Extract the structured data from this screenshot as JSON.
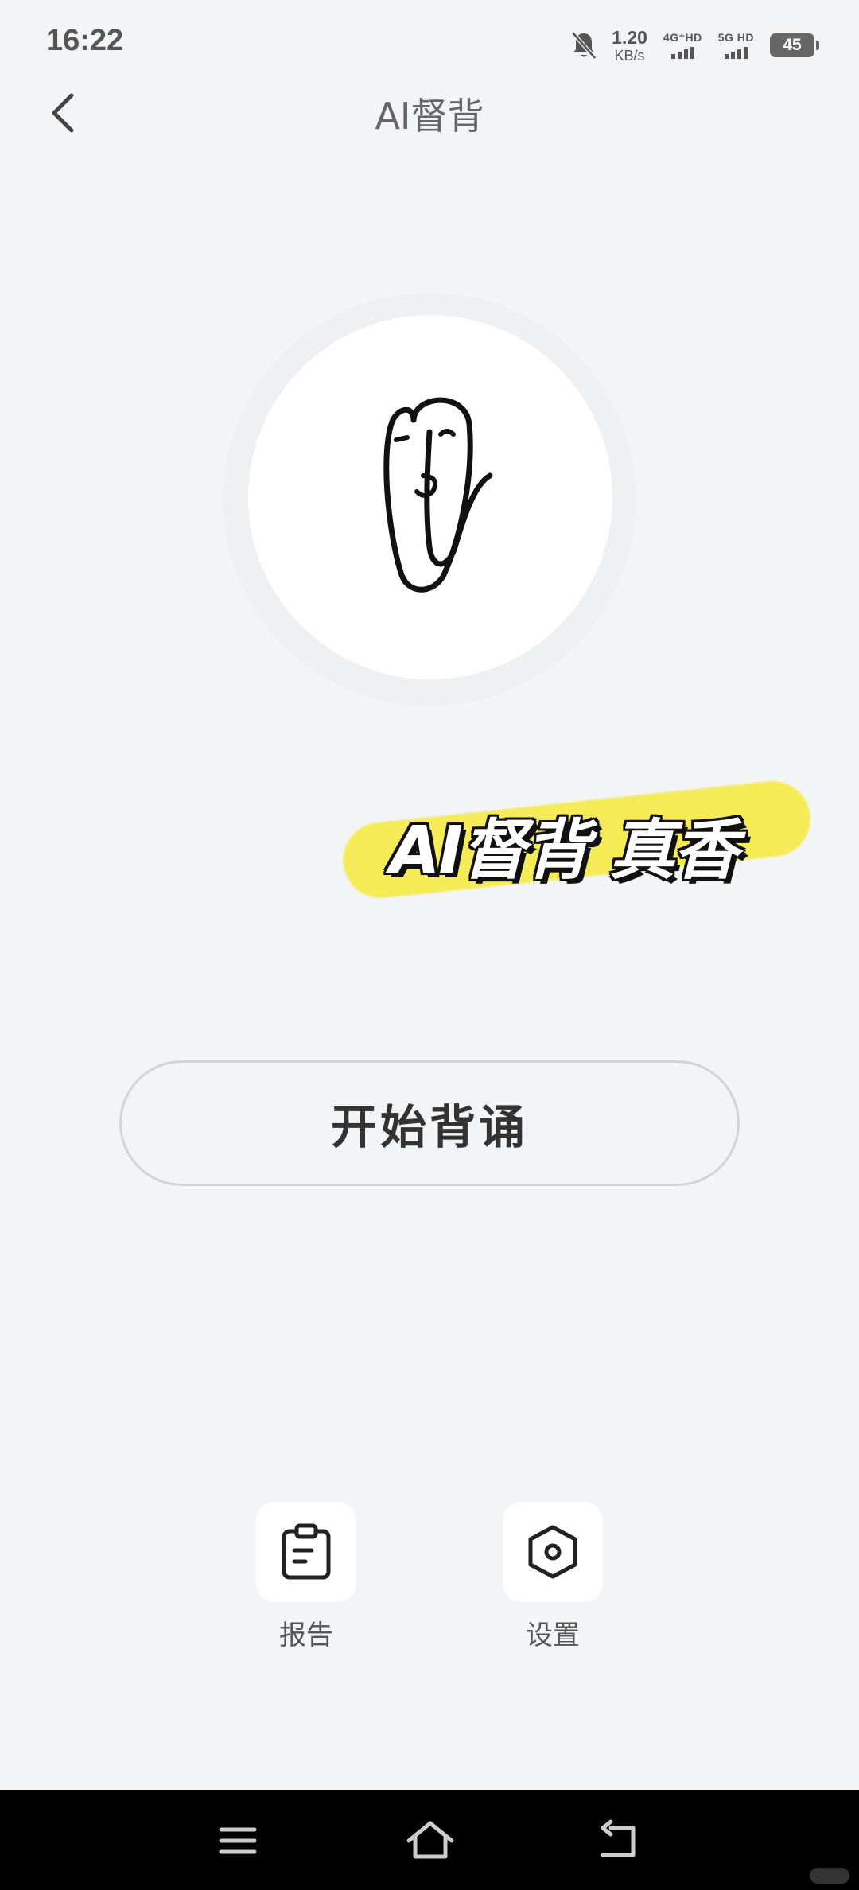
{
  "status_bar": {
    "time": "16:22",
    "speed_value": "1.20",
    "speed_unit": "KB/s",
    "sim1_label": "4G⁺HD",
    "sim2_label": "5G HD",
    "battery": "45",
    "icons": [
      "bell-muted-icon",
      "signal-icon",
      "battery-icon"
    ]
  },
  "header": {
    "title": "AI督背",
    "back_icon": "chevron-left-icon"
  },
  "hero": {
    "mascot_icon": "paperclip-mascot-icon",
    "slogan": "AI督背 真香",
    "highlight_color": "#f5ea3c"
  },
  "main": {
    "start_label": "开始背诵"
  },
  "shortcuts": {
    "report_label": "报告",
    "report_icon": "clipboard-icon",
    "settings_label": "设置",
    "settings_icon": "hexagon-settings-icon"
  },
  "system_nav": {
    "icons": [
      "menu-icon",
      "home-icon",
      "back-icon"
    ]
  }
}
